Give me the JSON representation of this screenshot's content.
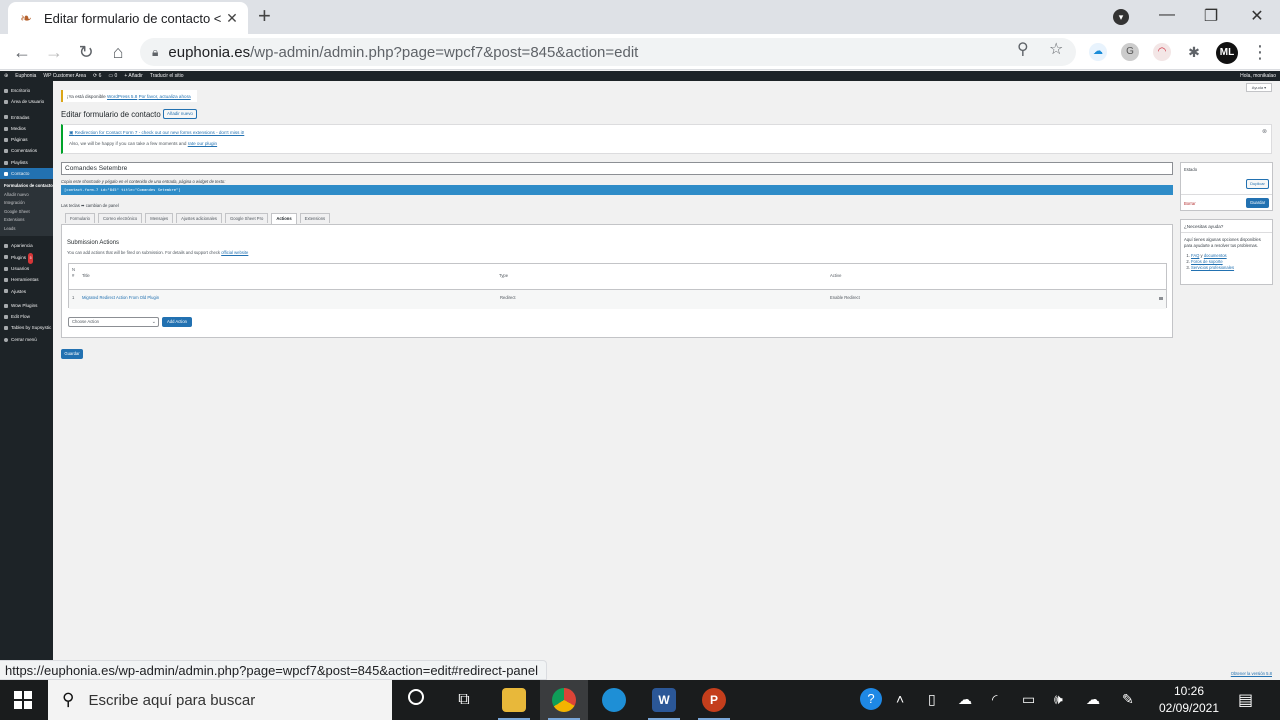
{
  "browser": {
    "tab_title": "Editar formulario de contacto < E",
    "tab_close": "✕",
    "new_tab": "+",
    "url_domain": "euphonia.es",
    "url_path": "/wp-admin/admin.php?page=wpcf7&post=845&action=edit",
    "status_url": "https://euphonia.es/wp-admin/admin.php?page=wpcf7&post=845&action=edit#redirect-panel",
    "avatar_text": "ML"
  },
  "adminbar": {
    "site": "Euphonia",
    "customer": "WP Customer Area",
    "updates": "6",
    "comments": "0",
    "new": "Añadir",
    "translate": "Traducir el sitio",
    "greeting": "Hola, monikalao"
  },
  "sidebar": {
    "items": [
      {
        "label": "Escritorio"
      },
      {
        "label": "Área de Usuario"
      },
      {
        "label": "Entradas"
      },
      {
        "label": "Medios"
      },
      {
        "label": "Páginas"
      },
      {
        "label": "Comentarios"
      },
      {
        "label": "Playlists"
      },
      {
        "label": "Contacto"
      }
    ],
    "sub_items": [
      {
        "label": "Formularios de contacto"
      },
      {
        "label": "Añadir nuevo"
      },
      {
        "label": "Integración"
      },
      {
        "label": "Google Sheet"
      },
      {
        "label": "Extensions"
      },
      {
        "label": "Leads"
      }
    ],
    "items2": [
      {
        "label": "Apariencia"
      },
      {
        "label": "Plugins",
        "badge": "5"
      },
      {
        "label": "Usuarios"
      },
      {
        "label": "Herramientas"
      },
      {
        "label": "Ajustes"
      },
      {
        "label": "Wow Plugins"
      },
      {
        "label": "Edit Flow"
      },
      {
        "label": "Tables by Supsystic"
      },
      {
        "label": "Cerrar menú"
      }
    ]
  },
  "content": {
    "help_label": "Ayuda ▾",
    "update_nag_text": "¡Ya está disponible ",
    "update_nag_link1": "WordPress 5.8",
    "update_nag_link2": "Por favor, actualiza ahora",
    "page_title": "Editar formulario de contacto",
    "add_new": "Añadir nuevo",
    "notice_line1": "Redirection for Contact Form 7 - check out our new forms extensions - don't miss it!",
    "notice_line2": "Also, we will be happy if you can take a few moments and ",
    "notice_link": "rate our plugin",
    "dismiss": "⊗",
    "form_title": "Comandes Setembre",
    "shortcode_note": "Copia este shortcode y pégalo en el contenido de una entrada, página o widget de texto:",
    "shortcode": "[contact-form-7 id=\"845\" title=\"Comandes Setembre\"]",
    "switch_panel": "Las teclas ⬌ cambian de panel",
    "tabs": [
      {
        "label": "Formulario"
      },
      {
        "label": "Correo electrónico"
      },
      {
        "label": "Mensajes"
      },
      {
        "label": "Ajustes adicionales"
      },
      {
        "label": "Google Sheet Pro"
      },
      {
        "label": "Actions"
      },
      {
        "label": "Extensions"
      }
    ],
    "panel_heading": "Submission Actions",
    "panel_desc": "You can add actions that will be fired on submission. For details and support check ",
    "panel_desc_link": "official website",
    "table": {
      "headers": [
        "N",
        "#",
        "Title",
        "Type",
        "Active"
      ],
      "row": {
        "num": "1",
        "title": "Migrated Redirect Action From Old Plugin",
        "type": "Redirect",
        "active": "Enable Redirect"
      }
    },
    "choose_action": "Choose Action",
    "add_action": "Add Action",
    "save": "Guardar",
    "status_title": "Estado",
    "duplicate": "Duplicar",
    "delete": "Borrar",
    "help_title": "¿Necesitas ayuda?",
    "help_desc": "Aquí tienes algunas opciones disponibles para ayudarte a resolver tus problemas.",
    "help_links": [
      "FAQ",
      "documentos",
      "Foros de soporte",
      "Servicios profesionales"
    ],
    "version_link": "Obtener la versión 5.8"
  },
  "taskbar": {
    "search_placeholder": "Escribe aquí para buscar",
    "time": "10:26",
    "date": "02/09/2021"
  }
}
